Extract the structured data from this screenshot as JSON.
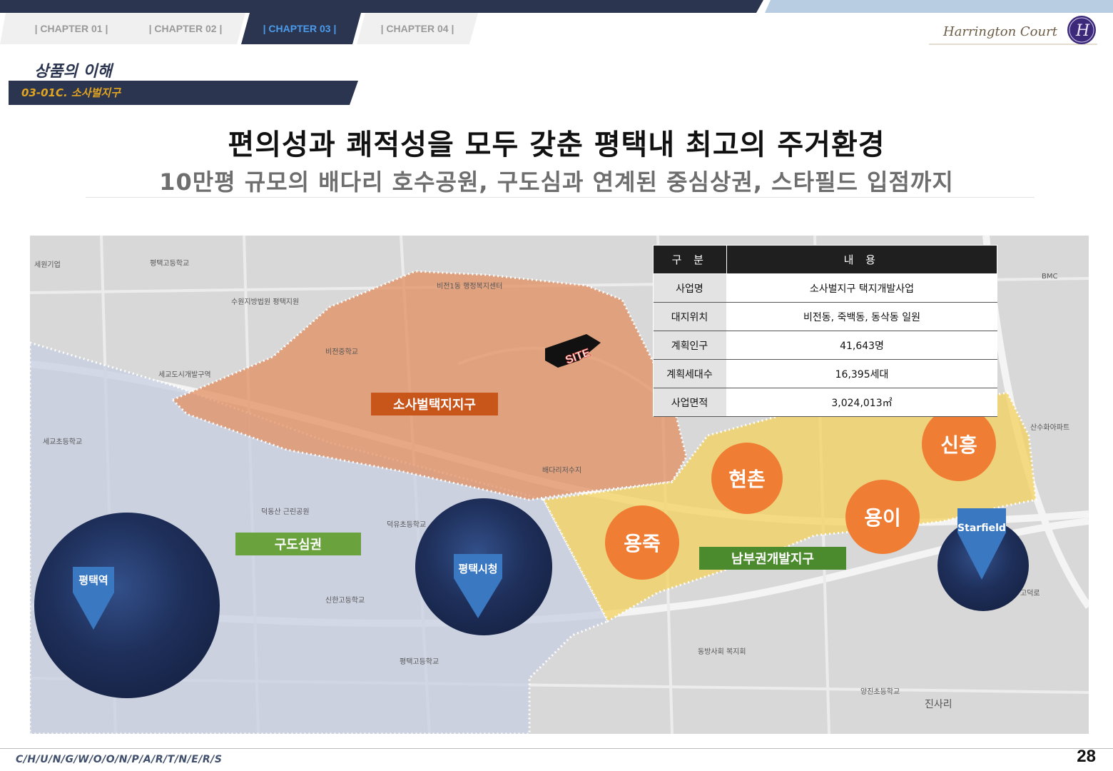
{
  "header": {
    "tabs": [
      {
        "label": "| CHAPTER 01 |",
        "active": false
      },
      {
        "label": "| CHAPTER 02 |",
        "active": false
      },
      {
        "label": "| CHAPTER 03 |",
        "active": true
      },
      {
        "label": "| CHAPTER 04 |",
        "active": false
      }
    ],
    "logo_text": "Harrington Court",
    "logo_mark": "H"
  },
  "section": {
    "title": "상품의 이해",
    "code": "03-01C. 소사벌지구"
  },
  "headline": "편의성과 쾌적성을 모두 갖춘 평택내 최고의 주거환경",
  "subheadline": "10만평 규모의 배다리 호수공원, 구도심과 연계된 중심상권, 스타필드 입점까지",
  "map": {
    "site_label": "SITE",
    "zones": {
      "sosabeol": "소사벌택지지구",
      "old_town": "구도심권",
      "south": "남부권개발지구"
    },
    "districts": [
      "현촌",
      "신흥",
      "용이",
      "용죽"
    ],
    "landmarks": {
      "station": "평택역",
      "city_hall": "평택시청",
      "starfield": "Starfield"
    },
    "background_labels": [
      "세원기업",
      "평택고등학교",
      "수원지방법원 평택지원",
      "비전1동 행정복지센터",
      "비전중학교",
      "세교도시개발구역",
      "신한고등학교",
      "덕동산 근린공원",
      "배다리저수지",
      "덕유초등학교",
      "평택고등학교",
      "진사리",
      "고덕로",
      "산수화아파트",
      "양진초등학교",
      "동방사회 복지회",
      "BMC",
      "세교초등학교"
    ],
    "colors": {
      "sosabeol_zone": "#e38f62",
      "south_zone": "#f4d35e",
      "old_town_zone": "#c7cfe2",
      "district_circle": "#ef7d34",
      "zone_label_orange": "#c8561b",
      "zone_label_green": "#6aa23e",
      "zone_label_darkgreen": "#4c8a2e",
      "pin_blue": "#3a78c2"
    }
  },
  "info_table": {
    "headers": [
      "구 분",
      "내 용"
    ],
    "rows": [
      {
        "key": "사업명",
        "value": "소사벌지구 택지개발사업"
      },
      {
        "key": "대지위치",
        "value": "비전동, 죽백동, 동삭동 일원"
      },
      {
        "key": "계획인구",
        "value": "41,643명"
      },
      {
        "key": "계획세대수",
        "value": "16,395세대"
      },
      {
        "key": "사업면적",
        "value": "3,024,013㎡"
      }
    ]
  },
  "footer": {
    "company": "C/H/U/N/G/W/O/O/N/P/A/R/T/N/E/R/S",
    "page": "28"
  }
}
